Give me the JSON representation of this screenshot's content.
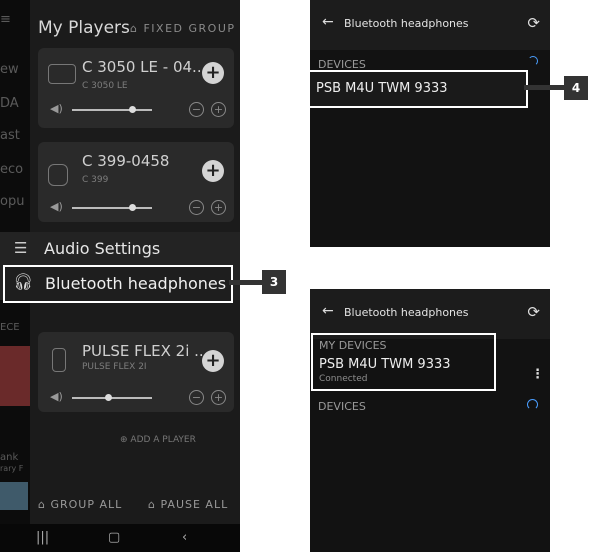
{
  "left_phone": {
    "title": "My Players",
    "fixed_group": "FIXED GROUP",
    "bg_fragments": [
      "ew",
      "DA",
      "ast",
      "eco",
      "opu",
      "ECE",
      "ank",
      "rary F"
    ],
    "players": [
      {
        "name": "C 3050 LE - 04...",
        "sub": "C 3050 LE",
        "volume": 0.75
      },
      {
        "name": "C 399-0458",
        "sub": "C 399",
        "volume": 0.75
      },
      {
        "name": "PULSE FLEX 2i ...",
        "sub": "PULSE FLEX 2I",
        "volume": 0.45
      }
    ],
    "menu": {
      "audio_settings": "Audio Settings",
      "bluetooth_headphones": "Bluetooth headphones"
    },
    "add_player": "ADD A PLAYER",
    "group_all": "GROUP ALL",
    "pause_all": "PAUSE ALL"
  },
  "top_phone": {
    "title": "Bluetooth headphones",
    "section": "DEVICES",
    "device": "PSB M4U TWM  9333"
  },
  "bottom_phone": {
    "title": "Bluetooth headphones",
    "my_devices": "MY DEVICES",
    "device": "PSB M4U TWM  9333",
    "status": "Connected",
    "devices": "DEVICES"
  },
  "callouts": {
    "three": "3",
    "four": "4"
  },
  "colors": {
    "accent": "#4a9eff",
    "callout_bg": "#333333",
    "highlight": "#ffffff"
  }
}
